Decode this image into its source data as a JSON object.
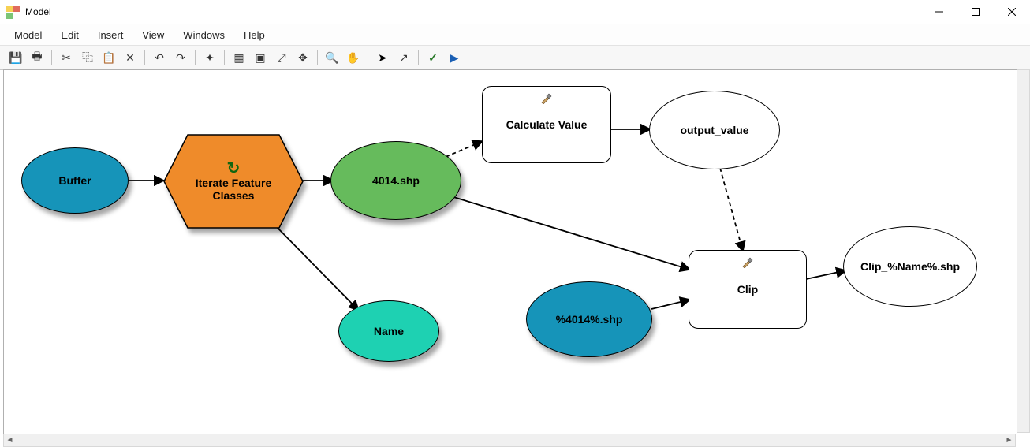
{
  "window": {
    "title": "Model"
  },
  "menubar": {
    "items": [
      "Model",
      "Edit",
      "Insert",
      "View",
      "Windows",
      "Help"
    ]
  },
  "toolbar": {
    "icons": [
      {
        "name": "save-icon",
        "glyph": "💾"
      },
      {
        "name": "print-icon",
        "glyph": "🖶"
      },
      {
        "type": "sep"
      },
      {
        "name": "cut-icon",
        "glyph": "✂"
      },
      {
        "name": "copy-icon",
        "glyph": "⿻"
      },
      {
        "name": "paste-icon",
        "glyph": "📋"
      },
      {
        "name": "delete-icon",
        "glyph": "✕"
      },
      {
        "type": "sep"
      },
      {
        "name": "undo-icon",
        "glyph": "↶"
      },
      {
        "name": "redo-icon",
        "glyph": "↷"
      },
      {
        "type": "sep"
      },
      {
        "name": "add-data-icon",
        "glyph": "✦"
      },
      {
        "type": "sep"
      },
      {
        "name": "auto-layout-icon",
        "glyph": "▦"
      },
      {
        "name": "full-extent-icon",
        "glyph": "▣"
      },
      {
        "name": "zoom-in-extent-icon",
        "glyph": "⤢"
      },
      {
        "name": "zoom-out-extent-icon",
        "glyph": "✥"
      },
      {
        "type": "sep"
      },
      {
        "name": "zoom-icon",
        "glyph": "🔍"
      },
      {
        "name": "pan-icon",
        "glyph": "✋"
      },
      {
        "type": "sep"
      },
      {
        "name": "select-icon",
        "glyph": "➤"
      },
      {
        "name": "connect-icon",
        "glyph": "↗"
      },
      {
        "type": "sep"
      },
      {
        "name": "validate-icon",
        "glyph": "✓"
      },
      {
        "name": "run-icon",
        "glyph": "▶"
      }
    ]
  },
  "nodes": {
    "buffer_label": "Buffer",
    "iterate_label": "Iterate Feature Classes",
    "shp_label": "4014.shp",
    "calc_label": "Calculate Value",
    "output_value_label": "output_value",
    "name_label": "Name",
    "var_shp_label": "%4014%.shp",
    "clip_label": "Clip",
    "clip_out_label": "Clip_%Name%.shp"
  },
  "colors": {
    "blue": "#1694b9",
    "orange": "#ef8b2a",
    "green": "#66bb5c",
    "cyan": "#1ed1b2",
    "white": "#ffffff"
  },
  "chart_data": {
    "type": "diagram",
    "nodes": [
      {
        "id": "buffer",
        "shape": "ellipse",
        "label": "Buffer",
        "fill": "blue",
        "paramInput": true
      },
      {
        "id": "iterate",
        "shape": "hexagon",
        "label": "Iterate Feature Classes",
        "fill": "orange",
        "iterator": true
      },
      {
        "id": "4014shp",
        "shape": "ellipse",
        "label": "4014.shp",
        "fill": "green"
      },
      {
        "id": "name",
        "shape": "ellipse",
        "label": "Name",
        "fill": "cyan"
      },
      {
        "id": "calcval",
        "shape": "round-rect",
        "label": "Calculate Value",
        "fill": "white",
        "tool": true
      },
      {
        "id": "outputval",
        "shape": "ellipse",
        "label": "output_value",
        "fill": "white"
      },
      {
        "id": "varshp",
        "shape": "ellipse",
        "label": "%4014%.shp",
        "fill": "blue",
        "paramInput": true
      },
      {
        "id": "clip",
        "shape": "round-rect",
        "label": "Clip",
        "fill": "white",
        "tool": true
      },
      {
        "id": "clipout",
        "shape": "ellipse",
        "label": "Clip_%Name%.shp",
        "fill": "white"
      }
    ],
    "edges": [
      {
        "from": "buffer",
        "to": "iterate",
        "style": "solid"
      },
      {
        "from": "iterate",
        "to": "4014shp",
        "style": "solid"
      },
      {
        "from": "iterate",
        "to": "name",
        "style": "solid"
      },
      {
        "from": "4014shp",
        "to": "calcval",
        "style": "dashed"
      },
      {
        "from": "calcval",
        "to": "outputval",
        "style": "solid"
      },
      {
        "from": "4014shp",
        "to": "clip",
        "style": "solid"
      },
      {
        "from": "outputval",
        "to": "clip",
        "style": "dashed"
      },
      {
        "from": "varshp",
        "to": "clip",
        "style": "solid"
      },
      {
        "from": "clip",
        "to": "clipout",
        "style": "solid"
      }
    ]
  }
}
